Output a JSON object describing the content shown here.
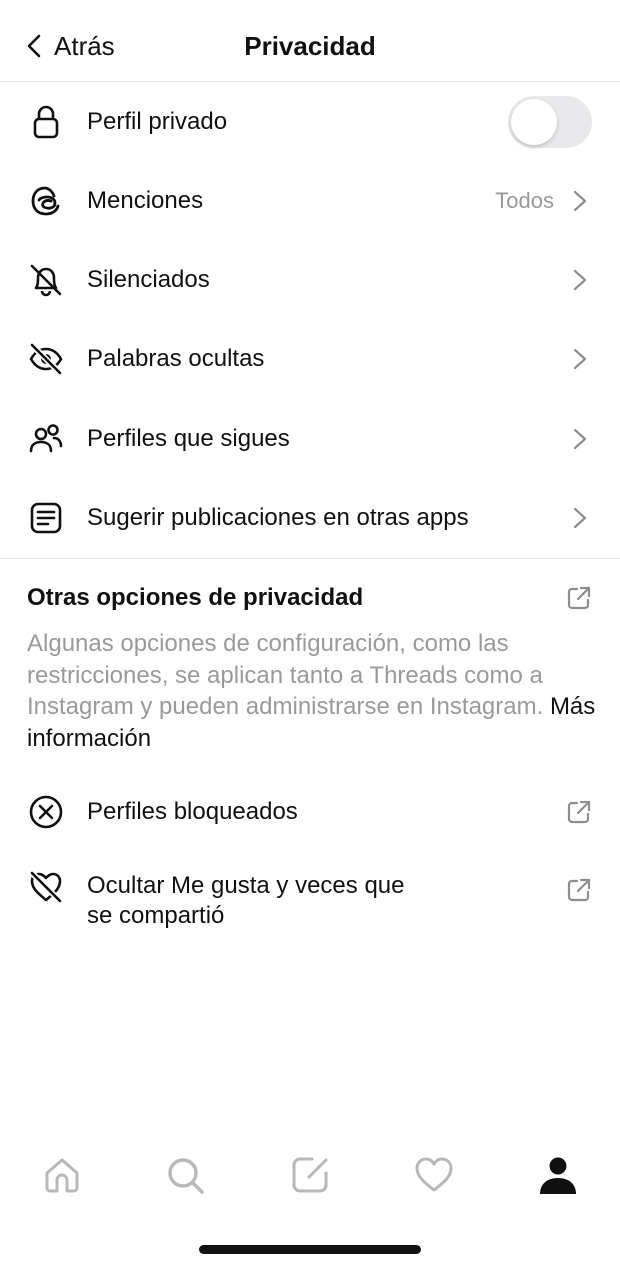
{
  "header": {
    "back_label": "Atrás",
    "title": "Privacidad"
  },
  "settings": [
    {
      "label": "Perfil privado",
      "icon": "lock-icon",
      "control": "toggle",
      "toggle_on": false
    },
    {
      "label": "Menciones",
      "icon": "threads-at-icon",
      "value": "Todos"
    },
    {
      "label": "Silenciados",
      "icon": "muted-bell-icon"
    },
    {
      "label": "Palabras ocultas",
      "icon": "hidden-eye-icon"
    },
    {
      "label": "Perfiles que sigues",
      "icon": "people-icon"
    },
    {
      "label": "Sugerir publicaciones en otras apps",
      "icon": "post-lines-icon"
    }
  ],
  "other_privacy": {
    "title": "Otras opciones de privacidad",
    "description": "Algunas opciones de configuración, como las restricciones, se aplican tanto a Threads como a Instagram y pueden administrarse en Instagram.",
    "more_link": "Más información",
    "items": [
      {
        "label": "Perfiles bloqueados",
        "icon": "blocked-circle-x-icon"
      },
      {
        "label_line1": "Ocultar Me gusta y veces que",
        "label_line2": "se compartió",
        "icon": "hidden-heart-icon"
      }
    ]
  },
  "bottom_nav": [
    {
      "name": "home-icon",
      "active": false
    },
    {
      "name": "search-icon",
      "active": false
    },
    {
      "name": "compose-icon",
      "active": false
    },
    {
      "name": "heart-icon",
      "active": false
    },
    {
      "name": "profile-icon",
      "active": true
    }
  ],
  "colors": {
    "text": "#111111",
    "secondary_text": "#999999",
    "divider": "#e6e6e6",
    "toggle_off": "#e9e9eb",
    "inactive_icon": "#b8b8b8"
  }
}
